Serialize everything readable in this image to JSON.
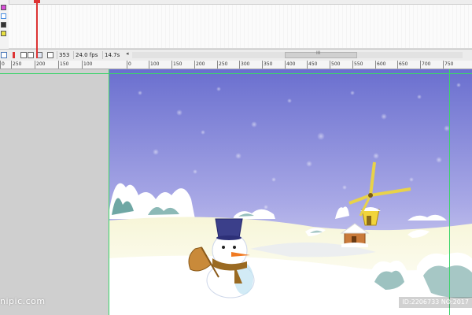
{
  "timeline": {
    "layers": [
      "layer-magenta",
      "layer-blue",
      "layer-dark",
      "layer-yellow"
    ],
    "layer_colors": [
      "#d94fd9",
      "#4d8fe0",
      "#333333",
      "#e8e040"
    ],
    "status": {
      "current_frame": "353",
      "frame_rate": "24.0 fps",
      "elapsed_time": "14.7s"
    },
    "scroll_grip": "III"
  },
  "ruler": {
    "labels": [
      "0",
      "100",
      "150",
      "200",
      "250",
      "300",
      "350",
      "400",
      "450",
      "500",
      "550",
      "600",
      "650",
      "700",
      "750"
    ],
    "far_left": "0",
    "left_marks": [
      "250",
      "200",
      "150"
    ]
  },
  "watermarks": {
    "left": "nipic.com",
    "right": "ID:2206733 NO:2017"
  },
  "colors": {
    "sky_top": "#6f74cf",
    "sky_bottom": "#e9e6f7",
    "snow": "#ffffff",
    "guide": "#3bd46a",
    "playhead": "#dd3333"
  },
  "scene": {
    "subject": "snowman",
    "hat": "bucket-hat",
    "windmill": "windmill",
    "house": "cottage"
  }
}
